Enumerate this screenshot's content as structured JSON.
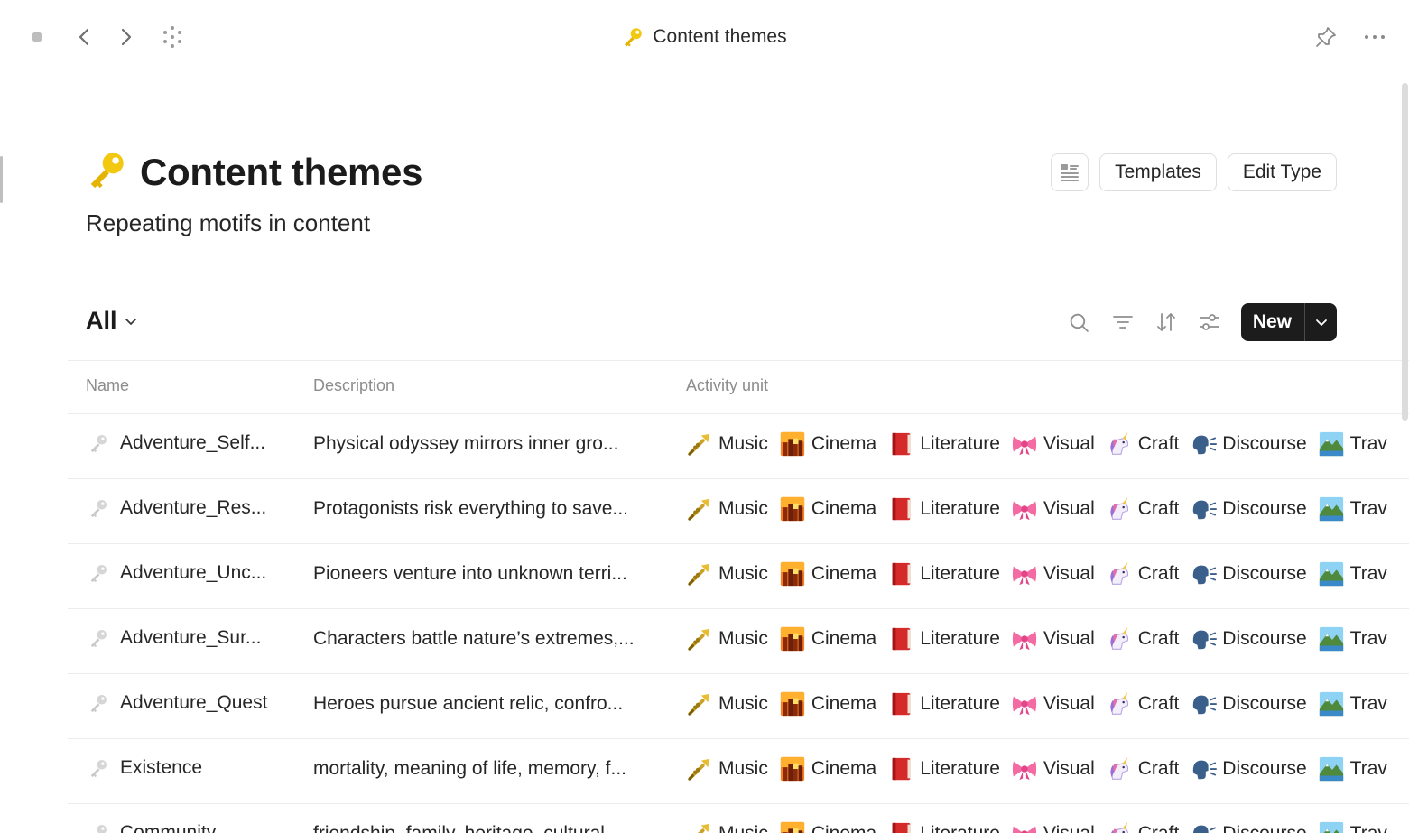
{
  "topbar": {
    "title": "Content themes"
  },
  "header": {
    "title": "Content themes",
    "subtitle": "Repeating motifs in content",
    "templates_label": "Templates",
    "edit_type_label": "Edit Type"
  },
  "view": {
    "selected": "All",
    "new_label": "New"
  },
  "table": {
    "columns": [
      "Name",
      "Description",
      "Activity unit"
    ],
    "activity_units": [
      {
        "label": "Music",
        "icon": "trumpet-icon"
      },
      {
        "label": "Cinema",
        "icon": "cityscape-icon"
      },
      {
        "label": "Literature",
        "icon": "red-book-icon"
      },
      {
        "label": "Visual",
        "icon": "ribbon-icon"
      },
      {
        "label": "Craft",
        "icon": "unicorn-icon"
      },
      {
        "label": "Discourse",
        "icon": "speaking-head-icon"
      },
      {
        "label": "Trav",
        "icon": "mountain-lake-icon"
      }
    ],
    "rows": [
      {
        "name": "Adventure_Self...",
        "description": "Physical odyssey mirrors inner gro..."
      },
      {
        "name": "Adventure_Res...",
        "description": "Protagonists risk everything to save..."
      },
      {
        "name": "Adventure_Unc...",
        "description": "Pioneers venture into unknown terri..."
      },
      {
        "name": "Adventure_Sur...",
        "description": "Characters battle nature’s extremes,..."
      },
      {
        "name": "Adventure_Quest",
        "description": "Heroes pursue ancient relic, confro..."
      },
      {
        "name": "Existence",
        "description": "mortality, meaning of life, memory, f..."
      },
      {
        "name": "Community",
        "description": "friendship, family, heritage, cultural..."
      }
    ]
  },
  "colors": {
    "accent_dark": "#1c1c1c",
    "key_yellow": "#f2c811",
    "border": "#ececec"
  }
}
